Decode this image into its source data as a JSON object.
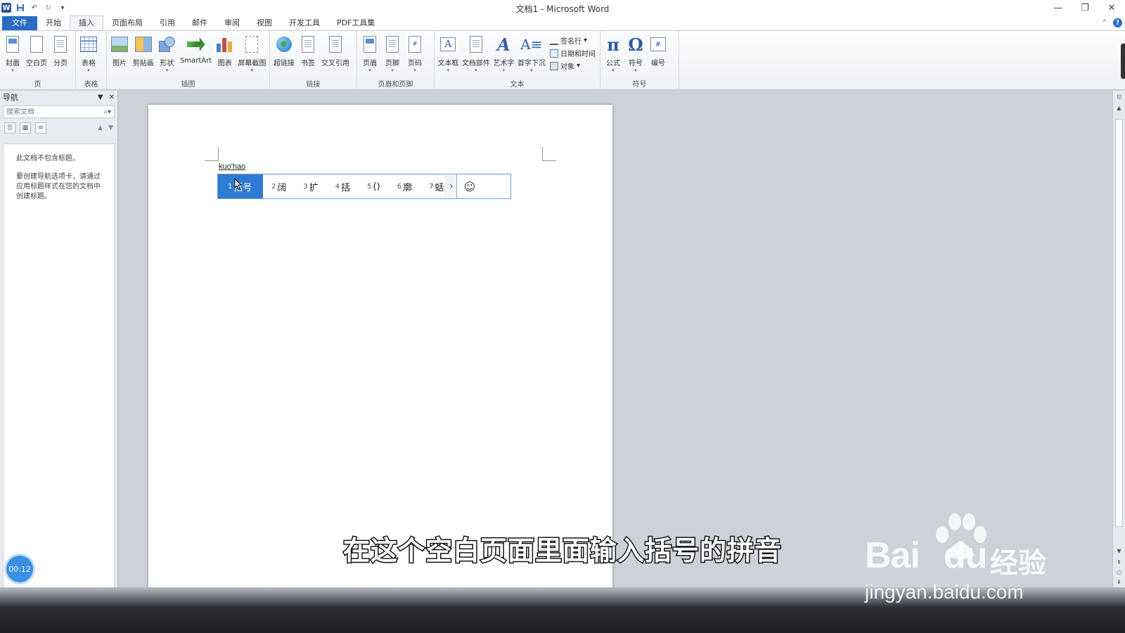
{
  "window": {
    "title": "文档1 - Microsoft Word",
    "controls": [
      "—",
      "❐",
      "✕"
    ]
  },
  "tabs": [
    "文件",
    "开始",
    "插入",
    "页面布局",
    "引用",
    "邮件",
    "审阅",
    "视图",
    "开发工具",
    "PDF工具集"
  ],
  "ribbon": {
    "groups": {
      "page": {
        "label": "页",
        "buttons": [
          "封面",
          "空白页",
          "分页"
        ]
      },
      "table": {
        "label": "表格",
        "buttons": [
          "表格"
        ]
      },
      "illustrations": {
        "label": "插图",
        "buttons": [
          "图片",
          "剪贴画",
          "形状",
          "SmartArt",
          "图表",
          "屏幕截图"
        ]
      },
      "links": {
        "label": "链接",
        "buttons": [
          "超链接",
          "书签",
          "交叉引用"
        ]
      },
      "header_footer": {
        "label": "页眉和页脚",
        "buttons": [
          "页眉",
          "页脚",
          "页码"
        ]
      },
      "text": {
        "label": "文本",
        "buttons": [
          "文本框",
          "文档部件",
          "艺术字",
          "首字下沉"
        ],
        "small": [
          "签名行",
          "日期和时间",
          "对象"
        ]
      },
      "symbols": {
        "label": "符号",
        "buttons": [
          "公式",
          "符号",
          "编号"
        ]
      }
    }
  },
  "nav": {
    "title": "导航",
    "search_placeholder": "搜索文档",
    "msg1": "此文档不包含标题。",
    "msg2": "要创建导航选项卡，请通过应用标题样式在您的文档中创建标题。"
  },
  "document": {
    "composing_text": "kuo'hao"
  },
  "ime": {
    "candidates": [
      {
        "n": "1",
        "text": "括号"
      },
      {
        "n": "2",
        "text": "阔"
      },
      {
        "n": "3",
        "text": "扩"
      },
      {
        "n": "4",
        "text": "括"
      },
      {
        "n": "5",
        "text": "()"
      },
      {
        "n": "6",
        "text": "廓"
      },
      {
        "n": "7",
        "text": "蛞"
      }
    ],
    "selected_index": 0
  },
  "overlay": {
    "subtitle": "在这个空白页面里面输入括号的拼音",
    "timer": "00:12",
    "watermark_brand": "Bai",
    "watermark_brand2": "du",
    "watermark_cn": "经验",
    "watermark_url": "jingyan.baidu.com"
  },
  "colors": {
    "accent": "#2b6cc4",
    "ime_selected": "#2f7bd3"
  }
}
